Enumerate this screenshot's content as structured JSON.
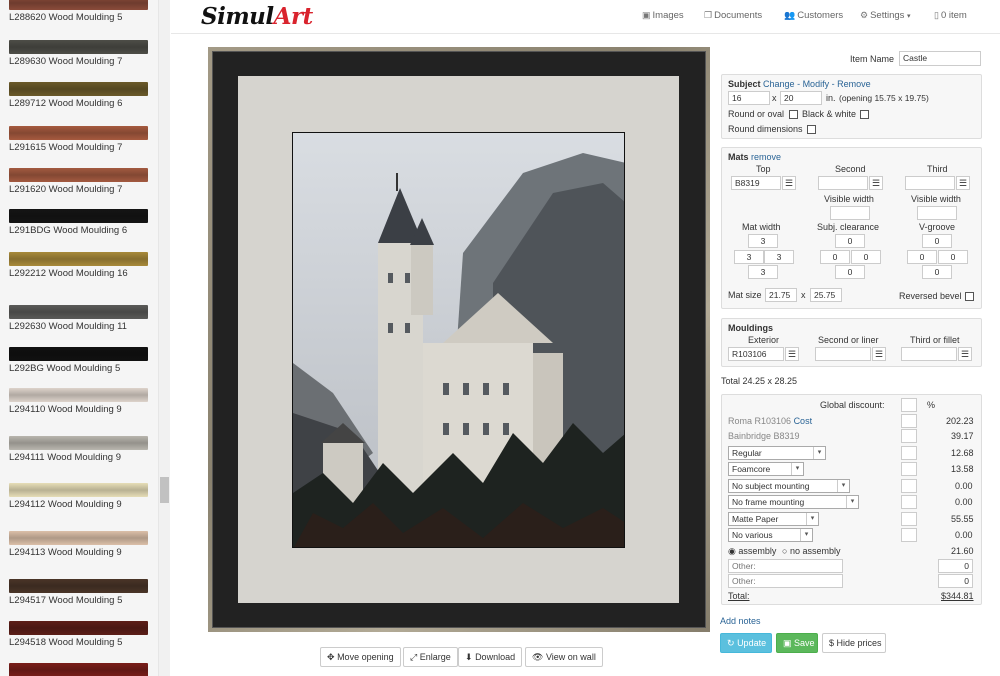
{
  "sidebar": {
    "items": [
      {
        "label": "L288620 Wood Moulding  5",
        "color": "#8a4b3a"
      },
      {
        "label": "L289630 Wood Moulding  7",
        "color": "#4d4d47"
      },
      {
        "label": "L289712 Wood Moulding  6",
        "color": "#6b5a2a"
      },
      {
        "label": "L291615 Wood Moulding  7",
        "color": "#a65a3f"
      },
      {
        "label": "L291620 Wood Moulding  7",
        "color": "#a35a40"
      },
      {
        "label": "L291BDG Wood Moulding  6",
        "color": "#151515"
      },
      {
        "label": "L292212 Wood Moulding  16",
        "color": "#a88a3a"
      },
      {
        "label": "L292630 Wood Moulding  11",
        "color": "#5a5a58"
      },
      {
        "label": "L292BG Wood Moulding  5",
        "color": "#111111"
      },
      {
        "label": "L294110 Wood Moulding  9",
        "color": "#ddd3cb"
      },
      {
        "label": "L294111 Wood Moulding  9",
        "color": "#b9b6ae"
      },
      {
        "label": "L294112 Wood Moulding  9",
        "color": "#e6ddb7"
      },
      {
        "label": "L294113 Wood Moulding  9",
        "color": "#dbbfa8"
      },
      {
        "label": "L294517 Wood Moulding  5",
        "color": "#4a3528"
      },
      {
        "label": "L294518 Wood Moulding  5",
        "color": "#5c1e18"
      },
      {
        "label": "",
        "color": "#7a1e1a"
      }
    ]
  },
  "header": {
    "logo_a": "Simul",
    "logo_b": "Art",
    "nav": [
      {
        "label": "Images",
        "icon": "image-icon"
      },
      {
        "label": "Documents",
        "icon": "documents-icon"
      },
      {
        "label": "Customers",
        "icon": "users-icon"
      },
      {
        "label": "Settings",
        "icon": "gear-icon"
      },
      {
        "label": "0 item",
        "icon": "file-icon"
      }
    ]
  },
  "preview_buttons": [
    "Move opening",
    "Enlarge",
    "Download",
    "View on wall"
  ],
  "form": {
    "item_name_label": "Item Name",
    "item_name": "Castle",
    "subject": {
      "title": "Subject",
      "change": "Change",
      "modify": "Modify",
      "remove": "Remove",
      "sep1": " - ",
      "sep2": " - ",
      "width": "16",
      "height": "20",
      "x": "x",
      "unit": "in.",
      "opening": "(opening 15.75 x 19.75)",
      "round_label": "Round or oval",
      "bw_label": "Black & white",
      "round_dims_label": "Round dimensions"
    },
    "mats": {
      "title": "Mats",
      "remove": "remove",
      "top": "Top",
      "second": "Second",
      "third": "Third",
      "top_code": "B8319",
      "visible_width": "Visible width",
      "visible_width2": "Visible width",
      "mat_width": "Mat width",
      "subj_clearance": "Subj. clearance",
      "vgroove": "V-groove",
      "mw": [
        "3",
        "3",
        "3",
        "3"
      ],
      "sc": [
        "0",
        "0",
        "0",
        "0"
      ],
      "vg": [
        "0",
        "0",
        "0",
        "0"
      ],
      "mat_size_label": "Mat size",
      "mat_w": "21.75",
      "x": "x",
      "mat_h": "25.75",
      "reversed": "Reversed bevel"
    },
    "mouldings": {
      "title": "Mouldings",
      "exterior": "Exterior",
      "second": "Second or liner",
      "third": "Third or fillet",
      "exterior_code": "R103106"
    },
    "total_size": "Total  24.25 x 28.25",
    "pricing": {
      "global_discount": "Global discount:",
      "pct": "%",
      "lines": [
        {
          "label": "Roma R103106",
          "extra": "Cost",
          "value": "202.23"
        },
        {
          "label": "Bainbridge B8319",
          "value": "39.17"
        }
      ],
      "selects": [
        {
          "value": "Regular",
          "price": "12.68"
        },
        {
          "value": "Foamcore",
          "price": "13.58"
        },
        {
          "value": "No subject mounting",
          "price": "0.00"
        },
        {
          "value": "No frame mounting",
          "price": "0.00"
        },
        {
          "value": "Matte Paper",
          "price": "55.55"
        },
        {
          "value": "No various",
          "price": "0.00"
        }
      ],
      "assembly": "assembly",
      "no_assembly": "no assembly",
      "assembly_price": "21.60",
      "other_placeholder": "Other:",
      "other1": "0",
      "other2": "0",
      "total_label": "Total:",
      "total_value": "$344.81"
    },
    "add_notes": "Add notes",
    "update": "Update",
    "save": "Save",
    "hide_prices": "Hide prices"
  },
  "colors": {
    "accent_blue": "#5bc0de",
    "accent_green": "#5cb85c",
    "brand_red": "#d9232d"
  }
}
